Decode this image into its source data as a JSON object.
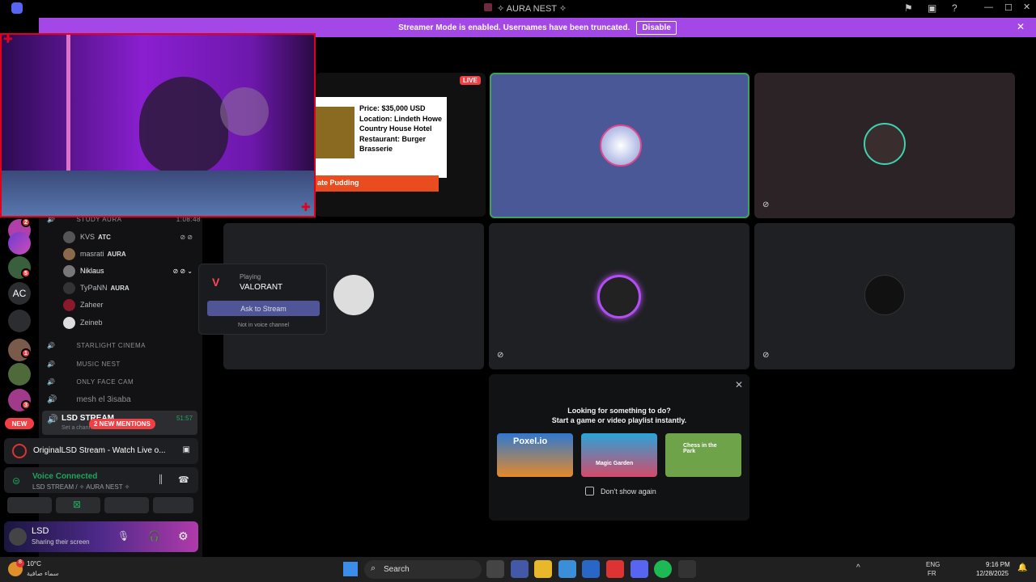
{
  "titlebar": {
    "title": "✧ AURA NEST ✧"
  },
  "banner": {
    "text": "Streamer Mode is enabled. Usernames have been truncated.",
    "button": "Disable"
  },
  "guilds": {
    "badges": [
      "2",
      "5",
      "1",
      "3"
    ],
    "ac_label": "AC",
    "new_label": "NEW"
  },
  "channels": [
    {
      "name": "STUDY AURA",
      "timer": "1:08:48"
    },
    {
      "name": "STARLIGHT CINEMA"
    },
    {
      "name": "MUSIC NEST"
    },
    {
      "name": "ONLY FACE CAM"
    },
    {
      "name": "mesh el 3isaba"
    },
    {
      "name": "LSD STREAM",
      "timer": "51:57",
      "sub": "Set a chann..."
    }
  ],
  "users": [
    {
      "name": "KVS",
      "tag": "ATC"
    },
    {
      "name": "masrati",
      "tag": "AURA"
    },
    {
      "name": "Niklaus",
      "tag": ""
    },
    {
      "name": "TyPaNN",
      "tag": "AURA"
    },
    {
      "name": "Zaheer",
      "tag": ""
    },
    {
      "name": "Zeineb",
      "tag": ""
    }
  ],
  "mentions": "2 NEW MENTIONS",
  "popup": {
    "status": "Playing",
    "game": "VALORANT",
    "button": "Ask to Stream",
    "note": "Not in voice channel"
  },
  "stream_preview": {
    "live": "LIVE",
    "lines": [
      "Price: $35,000 USD",
      "Location: Lindeth Howe Country House Hotel",
      "Restaurant: Burger Brasserie"
    ],
    "button_text": "ate Pudding"
  },
  "activity_card": {
    "title": "Looking for something to do?",
    "subtitle": "Start a game or video playlist instantly.",
    "games": [
      "Poxel.io",
      "Magic Garden",
      "Chess in the Park"
    ],
    "checkbox": "Don't show again"
  },
  "bottom_panel": {
    "stream_title": "OriginalLSD Stream - Watch Live o...",
    "voice_status": "Voice Connected",
    "voice_channel": "LSD STREAM / ✧ AURA NEST ✧",
    "user_name": "LSD",
    "user_status": "Sharing their screen"
  },
  "taskbar": {
    "temp": "10°C",
    "weather": "سماء صافية",
    "search": "Search",
    "lang1": "ENG",
    "lang2": "FR",
    "time": "9:16 PM",
    "date": "12/28/2025",
    "weather_badge": "8"
  }
}
